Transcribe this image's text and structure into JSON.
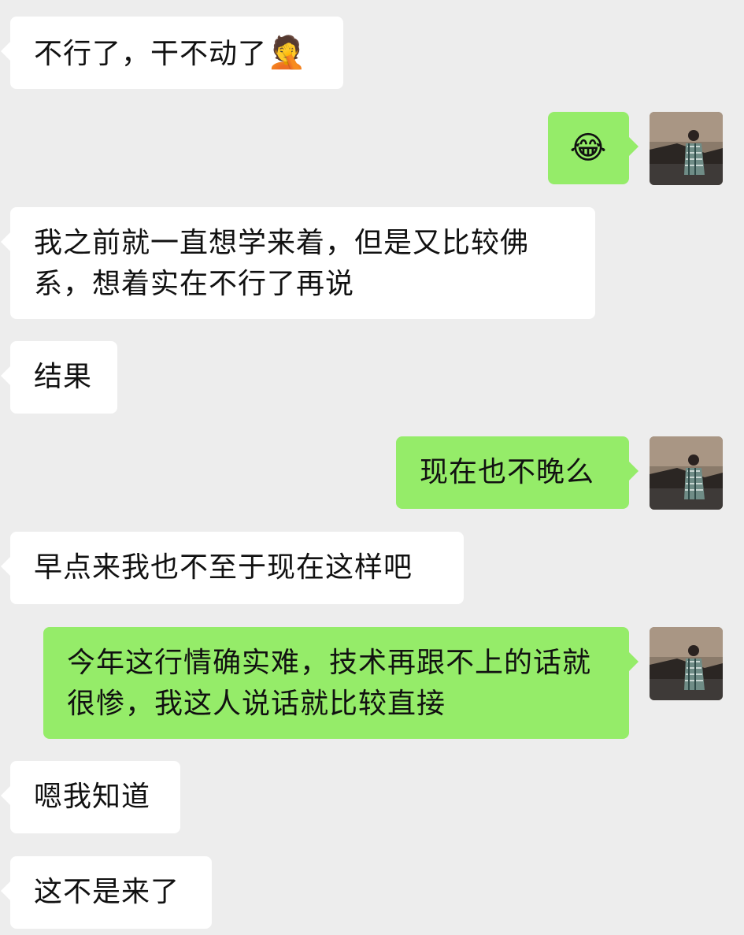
{
  "messages": [
    {
      "side": "left",
      "text": "不行了，干不动了",
      "emoji": "🤦"
    },
    {
      "side": "right",
      "text": "",
      "emoji": "😂"
    },
    {
      "side": "left",
      "text": "我之前就一直想学来着，但是又比较佛系，想着实在不行了再说"
    },
    {
      "side": "left",
      "text": "结果"
    },
    {
      "side": "right",
      "text": "现在也不晚么"
    },
    {
      "side": "left",
      "text": "早点来我也不至于现在这样吧"
    },
    {
      "side": "right",
      "text": "今年这行情确实难，技术再跟不上的话就很惨，我这人说话就比较直接"
    },
    {
      "side": "left",
      "text": "嗯我知道"
    },
    {
      "side": "left",
      "text": "这不是来了"
    }
  ],
  "colors": {
    "background": "#ededed",
    "incoming_bubble": "#ffffff",
    "outgoing_bubble": "#95ec69",
    "text": "#111111"
  },
  "avatar_icon": "user-avatar-photo"
}
